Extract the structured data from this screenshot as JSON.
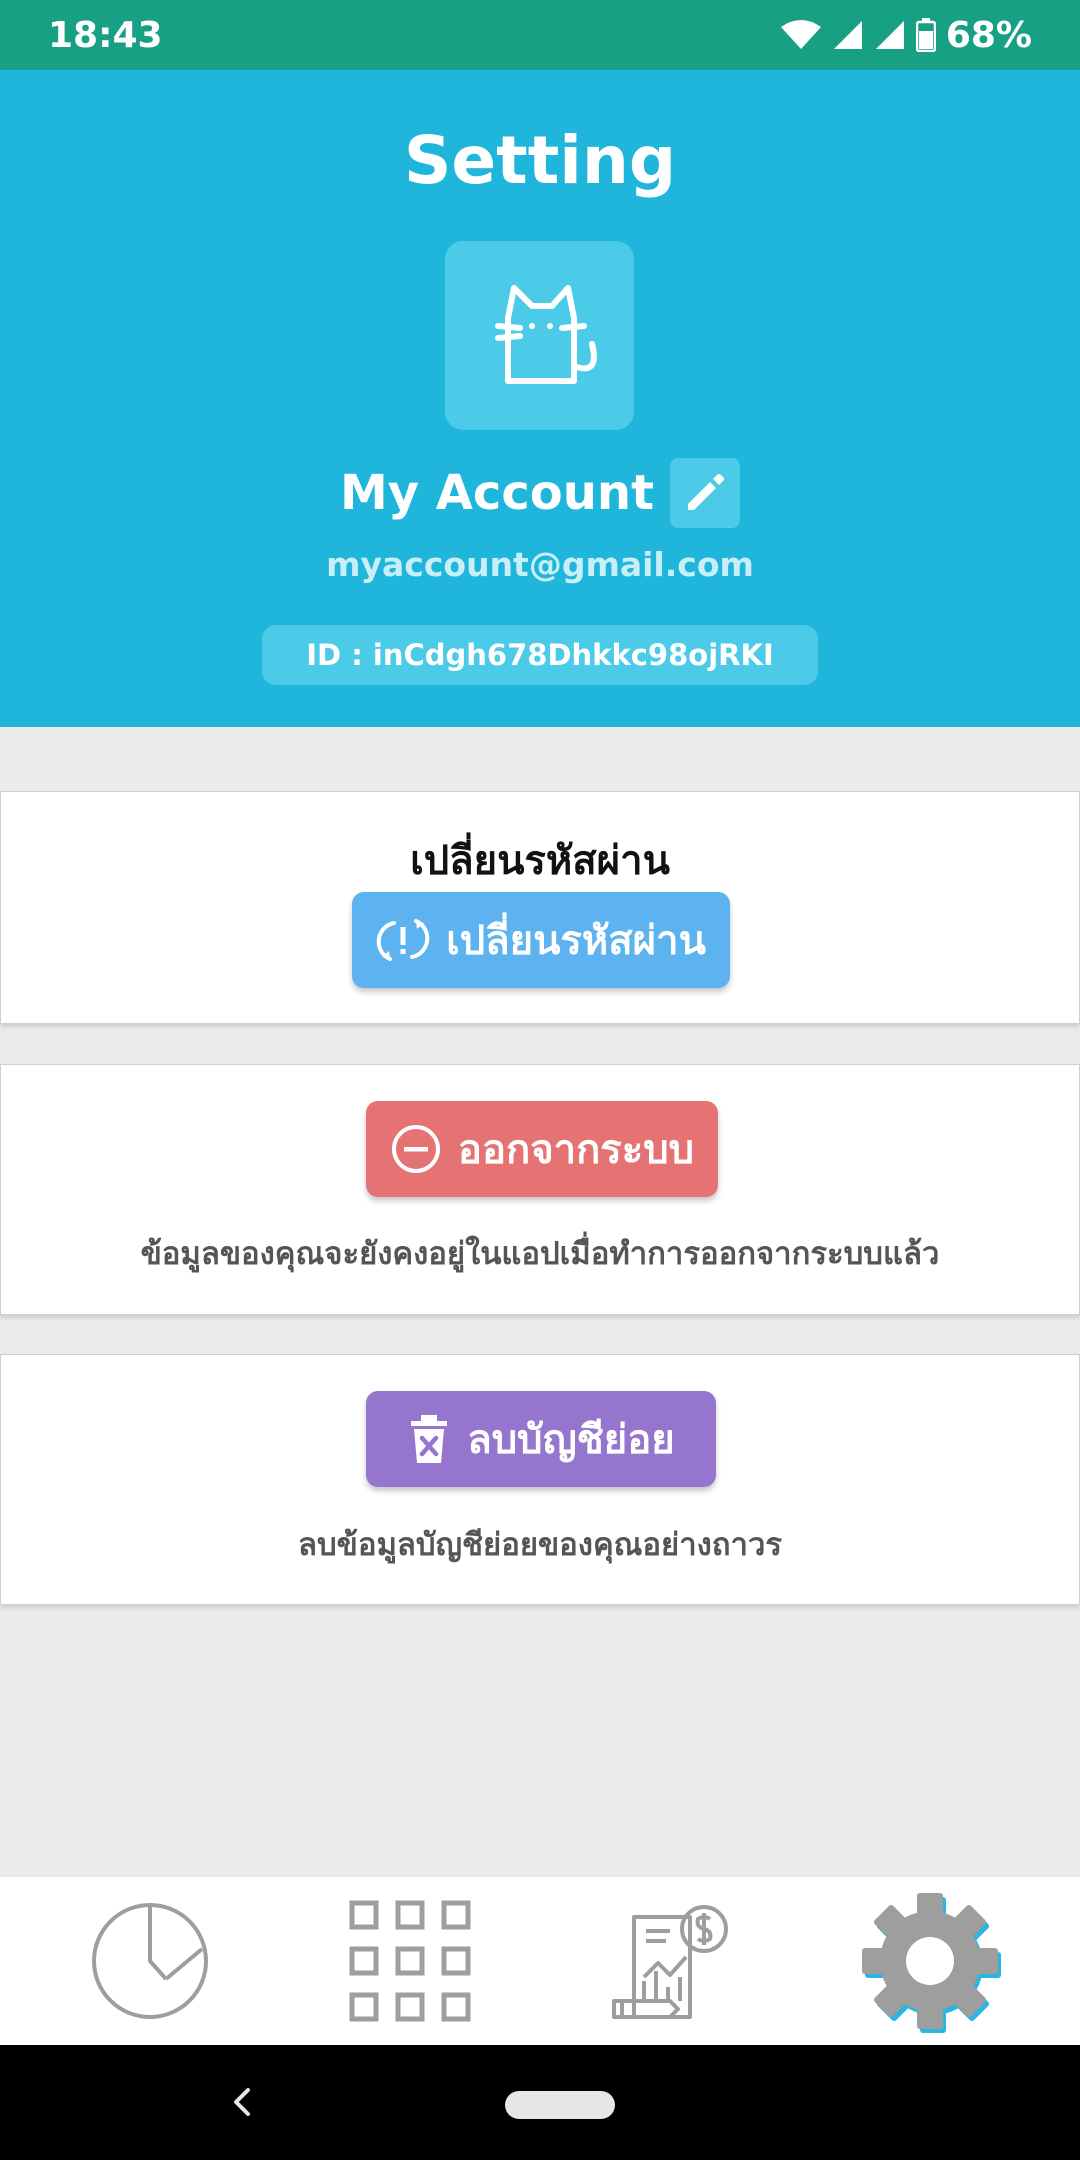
{
  "status_bar": {
    "time": "18:43",
    "battery": "68%",
    "icons": [
      "wifi-icon",
      "signal-icon",
      "signal-icon",
      "battery-icon"
    ]
  },
  "header": {
    "title": "Setting",
    "account_name": "My Account",
    "email": "myaccount@gmail.com",
    "id_label": "ID : inCdgh678Dhkkc98ojRKI",
    "avatar_icon": "cat-icon",
    "edit_icon": "pencil-icon"
  },
  "cards": {
    "change_password": {
      "heading": "เปลี่ยนรหัสผ่าน",
      "button_label": "เปลี่ยนรหัสผ่าน",
      "button_icon": "refresh-alert-icon"
    },
    "logout": {
      "button_label": "ออกจากระบบ",
      "button_icon": "minus-circle-icon",
      "note": "ข้อมูลของคุณจะยังคงอยู่ในแอปเมื่อทำการออกจากระบบแล้ว"
    },
    "delete_sub_account": {
      "button_label": "ลบบัญชีย่อย",
      "button_icon": "trash-icon",
      "note": "ลบข้อมูลบัญชีย่อยของคุณอย่างถาวร"
    }
  },
  "bottom_nav": {
    "items": [
      "pie-chart-icon",
      "grid-icon",
      "report-icon",
      "gear-icon"
    ],
    "active": "gear-icon"
  },
  "colors": {
    "status_bar": "#17a084",
    "header": "#20b5da",
    "change_button": "#5cb3f0",
    "logout_button": "#e57373",
    "delete_button": "#9575cd"
  }
}
